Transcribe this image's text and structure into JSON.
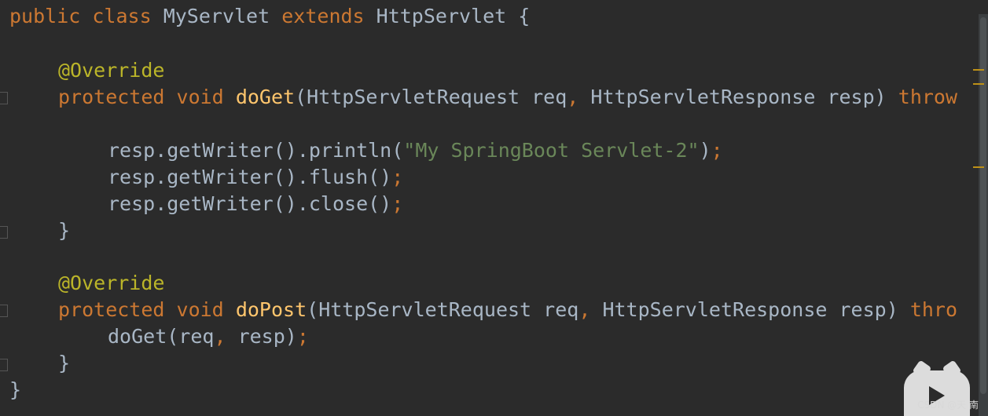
{
  "code": {
    "l1": {
      "kw1": "public",
      "kw2": "class",
      "name": "MyServlet",
      "kw3": "extends",
      "parent": "HttpServlet",
      "brace": "{"
    },
    "l3": {
      "ann": "@Override"
    },
    "l4": {
      "kw1": "protected",
      "kw2": "void",
      "fn": "doGet",
      "open": "(",
      "p1": "HttpServletRequest req",
      "comma": ",",
      "p2": "HttpServletResponse resp",
      "close": ")",
      "tail": "throw"
    },
    "l6": {
      "call": "resp.getWriter().println(",
      "str": "\"My SpringBoot Servlet-2\"",
      "close": ")",
      "semi": ";"
    },
    "l7": {
      "call": "resp.getWriter().flush()",
      "semi": ";"
    },
    "l8": {
      "call": "resp.getWriter().close()",
      "semi": ";"
    },
    "l9": {
      "brace": "}"
    },
    "l11": {
      "ann": "@Override"
    },
    "l12": {
      "kw1": "protected",
      "kw2": "void",
      "fn": "doPost",
      "open": "(",
      "p1": "HttpServletRequest req",
      "comma": ",",
      "p2": "HttpServletResponse resp",
      "close": ")",
      "tail": "thro"
    },
    "l13": {
      "call": "doGet(req",
      "comma": ",",
      "rest": " resp)",
      "semi": ";"
    },
    "l14": {
      "brace": "}"
    },
    "l15": {
      "brace": "}"
    }
  },
  "watermark": "CSDN @天 南",
  "colors": {
    "background": "#2b2b2b",
    "keyword": "#cc7832",
    "annotation": "#bbb529",
    "method": "#ffc66d",
    "string": "#6a8759",
    "text": "#a9b7c6"
  }
}
